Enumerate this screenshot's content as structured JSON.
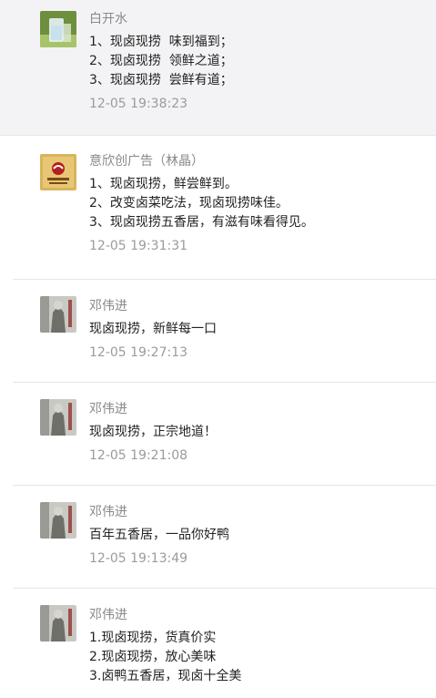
{
  "messages": [
    {
      "name": "白开水",
      "lines": [
        "1、现卤现捞  味到福到；",
        "2、现卤现捞  领鲜之道；",
        "3、现卤现捞  尝鲜有道；"
      ],
      "time": "12-05 19:38:23"
    },
    {
      "name": "意欣创广告（林晶）",
      "lines": [
        "1、现卤现捞，鲜尝鲜到。",
        "2、改变卤菜吃法，现卤现捞味佳。",
        "3、现卤现捞五香居，有滋有味看得见。"
      ],
      "time": "12-05 19:31:31"
    },
    {
      "name": "邓伟进",
      "lines": [
        "现卤现捞，新鲜每一口"
      ],
      "time": "12-05 19:27:13"
    },
    {
      "name": "邓伟进",
      "lines": [
        "现卤现捞，正宗地道！"
      ],
      "time": "12-05 19:21:08"
    },
    {
      "name": "邓伟进",
      "lines": [
        "百年五香居，一品你好鸭"
      ],
      "time": "12-05 19:13:49"
    },
    {
      "name": "邓伟进",
      "lines": [
        "1.现卤现捞，货真价实",
        "2.现卤现捞，放心美味",
        "3.卤鸭五香居，现卤十全美"
      ],
      "time": ""
    }
  ]
}
